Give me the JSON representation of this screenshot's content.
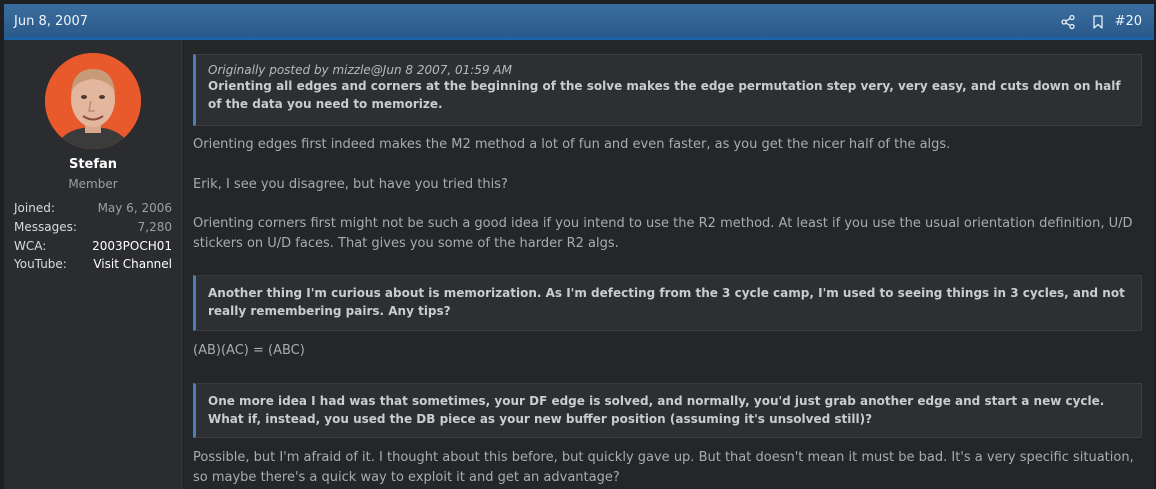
{
  "header": {
    "date": "Jun 8, 2007",
    "post_number": "#20",
    "share_icon": "share-icon",
    "bookmark_icon": "bookmark-icon"
  },
  "user": {
    "name": "Stefan",
    "title": "Member",
    "stats": [
      {
        "label": "Joined:",
        "value": "May 6, 2006"
      },
      {
        "label": "Messages:",
        "value": "7,280"
      },
      {
        "label": "WCA:",
        "value": "2003POCH01"
      },
      {
        "label": "YouTube:",
        "value": "Visit Channel"
      }
    ]
  },
  "content": {
    "quote1": {
      "attribution": "Originally posted by mizzle@Jun 8 2007, 01:59 AM",
      "text": "Orienting all edges and corners at the beginning of the solve makes the edge permutation step very, very easy, and cuts down on half of the data you need to memorize."
    },
    "p1": "Orienting edges first indeed makes the M2 method a lot of fun and even faster, as you get the nicer half of the algs.",
    "p2": "Erik, I see you disagree, but have you tried this?",
    "p3": "Orienting corners first might not be such a good idea if you intend to use the R2 method. At least if you use the usual orientation definition, U/D stickers on U/D faces. That gives you some of the harder R2 algs.",
    "quote2": {
      "text": "Another thing I'm curious about is memorization. As I'm defecting from the 3 cycle camp, I'm used to seeing things in 3 cycles, and not really remembering pairs. Any tips?"
    },
    "p4": "(AB)(AC) = (ABC)",
    "quote3": {
      "text": "One more idea I had was that sometimes, your DF edge is solved, and normally, you'd just grab another edge and start a new cycle. What if, instead, you used the DB piece as your new buffer position (assuming it's unsolved still)?"
    },
    "p5": "Possible, but I'm afraid of it. I thought about this before, but quickly gave up. But that doesn't mean it must be bad. It's a very specific situation, so maybe there's a quick way to exploit it and get an advantage?"
  },
  "colors": {
    "header_bg": "#2f6496",
    "accent_border": "#1a63a8",
    "quote_border": "#4a7fb5",
    "page_bg": "#252628"
  }
}
